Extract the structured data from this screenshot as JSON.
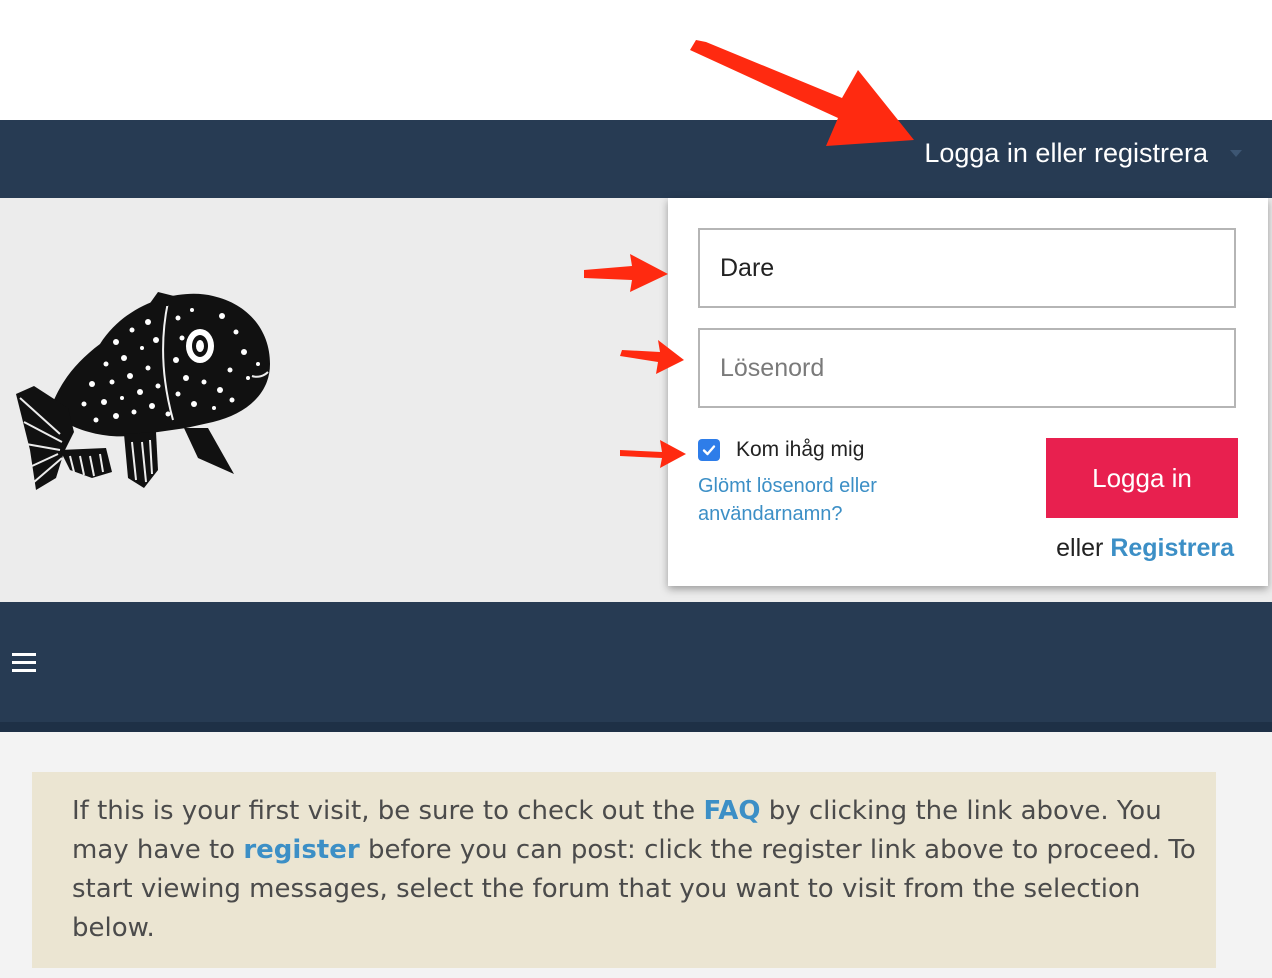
{
  "header": {
    "login_toggle_label": "Logga in eller registrera"
  },
  "login_form": {
    "username_value": "Dare",
    "password_placeholder": "Lösenord",
    "remember_label": "Kom ihåg mig",
    "remember_checked": true,
    "forgot_link": "Glömt lösenord eller användarnamn?",
    "submit_label": "Logga in",
    "or_text": "eller",
    "register_link": "Registrera"
  },
  "notice": {
    "part1": "If this is your first visit, be sure to check out the ",
    "faq_link": "FAQ",
    "part2": " by clicking the link above. You may have to ",
    "register_link": "register",
    "part3": " before you can post: click the register link above to proceed. To start viewing messages, select the forum that you want to visit from the selection below."
  },
  "icons": {
    "logo": "fish-logo-icon",
    "menu": "hamburger-menu-icon",
    "caret": "caret-down-icon",
    "check": "checkmark-icon",
    "annotation": "red-arrow-icon"
  },
  "colors": {
    "header_bg": "#273b53",
    "banner_bg": "#ececec",
    "accent_link": "#3c8fc6",
    "login_button": "#e8204f",
    "notice_bg": "#ebe5d2",
    "annotation_arrow": "#ff2a10"
  }
}
